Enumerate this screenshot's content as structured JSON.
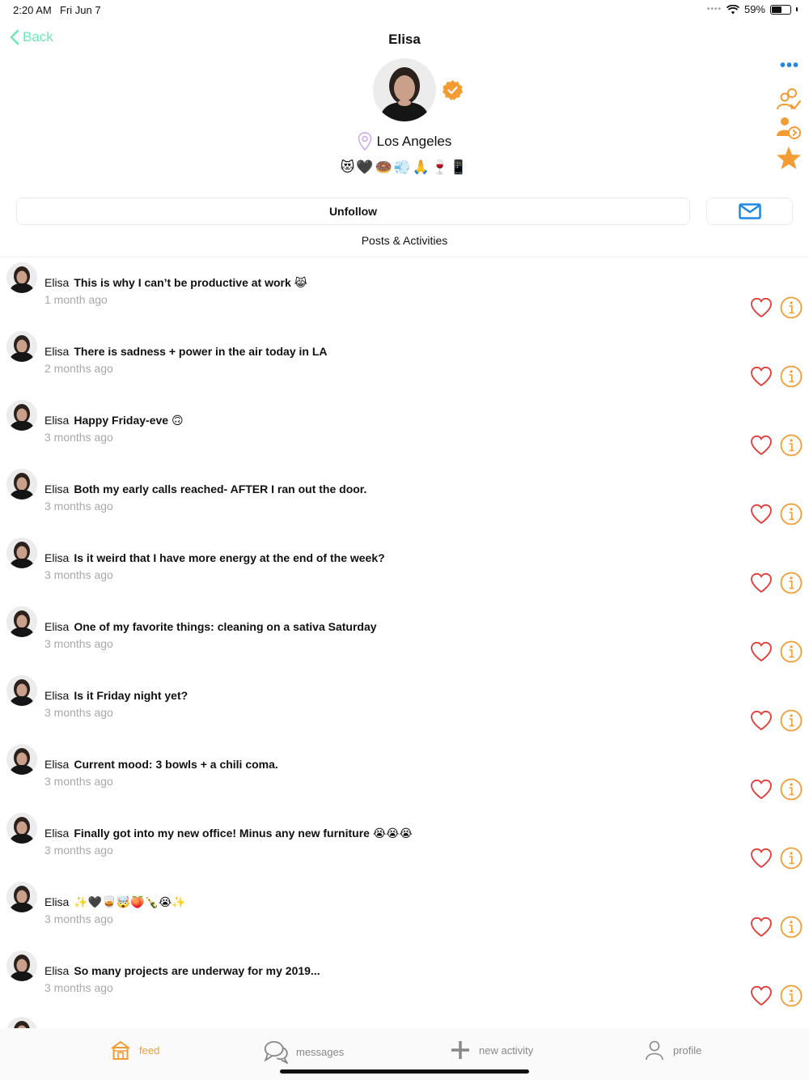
{
  "status_bar": {
    "time": "2:20 AM",
    "date": "Fri Jun 7",
    "battery": "59%",
    "battery_level": 0.59
  },
  "nav": {
    "back_label": "Back",
    "title": "Elisa",
    "more_icon": "more-dots-icon"
  },
  "profile": {
    "verified_icon": "verified-badge-icon",
    "location": "Los Angeles",
    "emojis": "😻🖤🍩💨🙏🍷📱"
  },
  "side_actions": [
    "friends-check-icon",
    "user-follow-icon",
    "star-icon"
  ],
  "actions": {
    "unfollow_label": "Unfollow",
    "mail_icon": "mail-icon"
  },
  "section_title": "Posts & Activities",
  "posts": [
    {
      "author": "Elisa",
      "text": "This is why I can’t be productive at work 😹",
      "time": "1 month ago"
    },
    {
      "author": "Elisa",
      "text": "There is sadness + power in the air today in LA",
      "time": "2 months ago"
    },
    {
      "author": "Elisa",
      "text": "Happy Friday-eve 🙃",
      "time": "3 months ago"
    },
    {
      "author": "Elisa",
      "text": "Both my early calls reached- AFTER I ran out the door.",
      "time": "3 months ago"
    },
    {
      "author": "Elisa",
      "text": "Is it weird that I have more energy at the end of the week?",
      "time": "3 months ago"
    },
    {
      "author": "Elisa",
      "text": "One of my favorite things: cleaning on a sativa Saturday",
      "time": "3 months ago"
    },
    {
      "author": "Elisa",
      "text": "Is it Friday night yet?",
      "time": "3 months ago"
    },
    {
      "author": "Elisa",
      "text": "Current mood: 3 bowls + a chili coma.",
      "time": "3 months ago"
    },
    {
      "author": "Elisa",
      "text": "Finally got into my new office! Minus any new furniture 😭😭😭",
      "time": "3 months ago"
    },
    {
      "author": "Elisa",
      "text": "✨🖤🥃🤯🍑🍾😭✨",
      "time": "3 months ago"
    },
    {
      "author": "Elisa",
      "text": "So many projects are underway for my 2019...",
      "time": "3 months ago"
    }
  ],
  "tabs": [
    {
      "label": "feed",
      "icon": "home-icon",
      "active": true
    },
    {
      "label": "messages",
      "icon": "chat-bubbles-icon",
      "active": false
    },
    {
      "label": "new activity",
      "icon": "plus-icon",
      "active": false
    },
    {
      "label": "profile",
      "icon": "person-icon",
      "active": false
    }
  ],
  "colors": {
    "accent": "#f39c34",
    "back": "#6ee7b7",
    "heart": "#e53935",
    "link": "#1e88e5"
  }
}
